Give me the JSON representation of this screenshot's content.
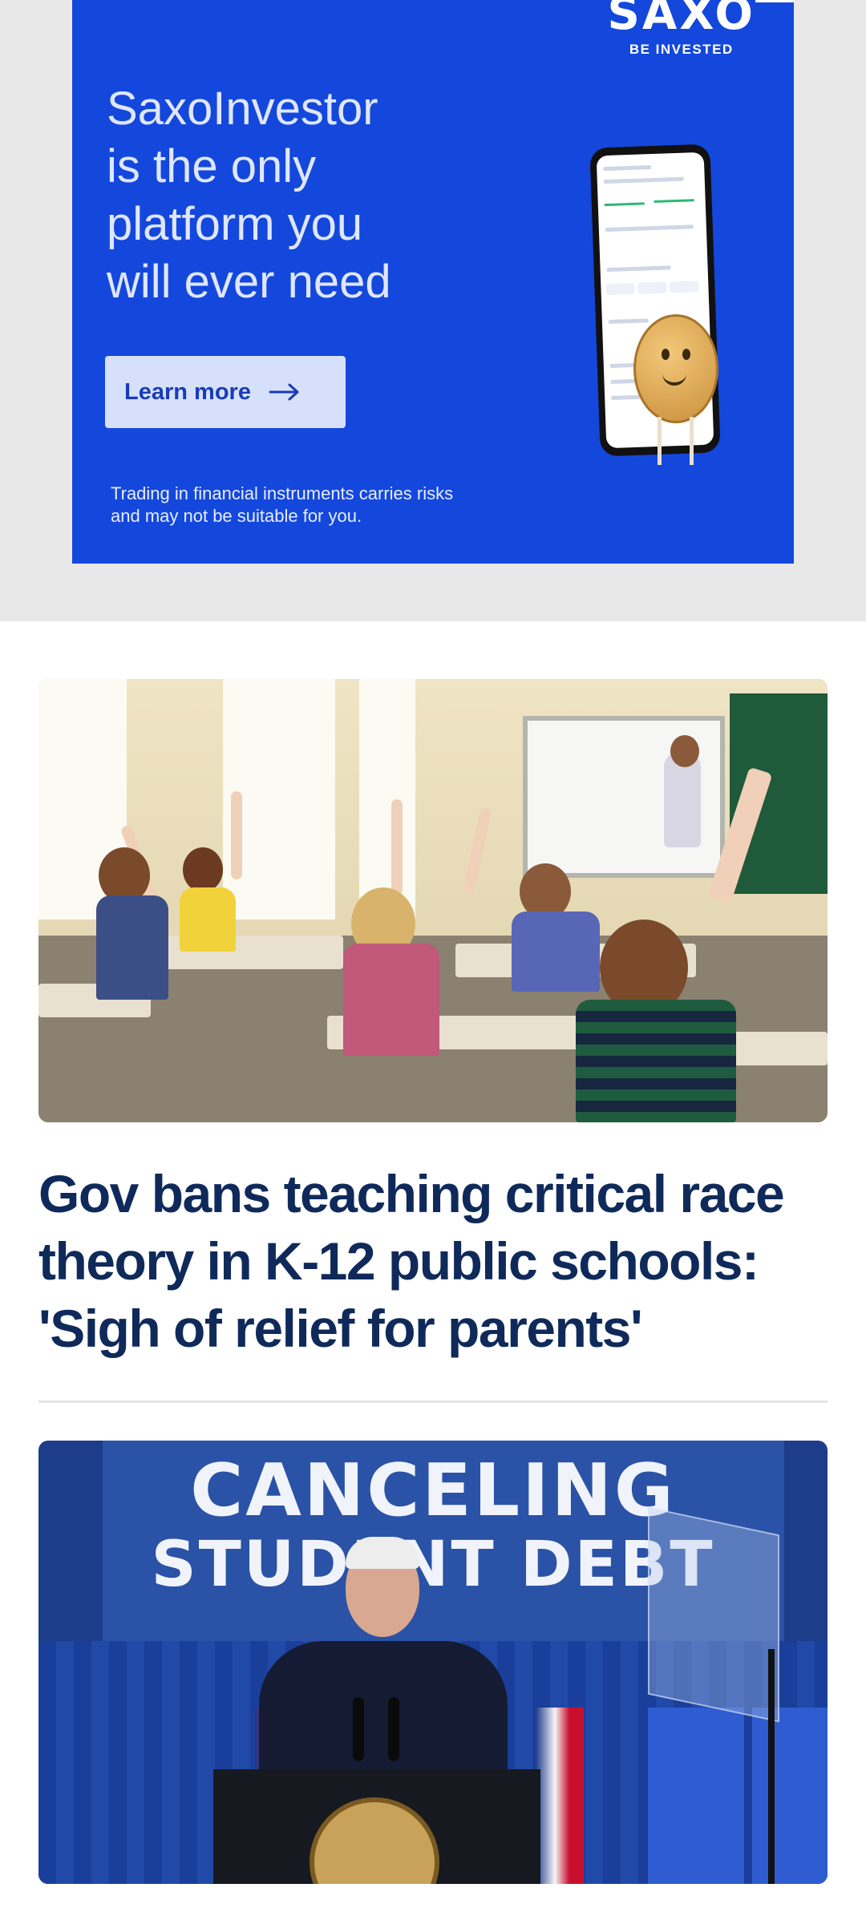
{
  "ad": {
    "brand": "SAXO",
    "tagline": "BE INVESTED",
    "headline_lines": [
      "SaxoInvestor",
      "is the only",
      "platform you",
      "will ever need"
    ],
    "cta_label": "Learn more",
    "disclaimer_lines": [
      "Trading in financial instruments carries risks",
      "and may not be suitable for you."
    ],
    "colors": {
      "background": "#1448dc",
      "button": "#d7e0fb"
    }
  },
  "articles": [
    {
      "image_alt": "Classroom with children raising hands",
      "title_lines": [
        "Gov bans teaching critical race",
        "theory in K-12 public schools:",
        "'Sigh of relief for parents'"
      ]
    },
    {
      "image_alt": "Speaker at podium under banner",
      "banner_lines": [
        "CANCELING",
        "STUDENT DEBT"
      ]
    }
  ],
  "colors": {
    "title": "#0f2a5a",
    "divider": "#e3e3e3"
  }
}
